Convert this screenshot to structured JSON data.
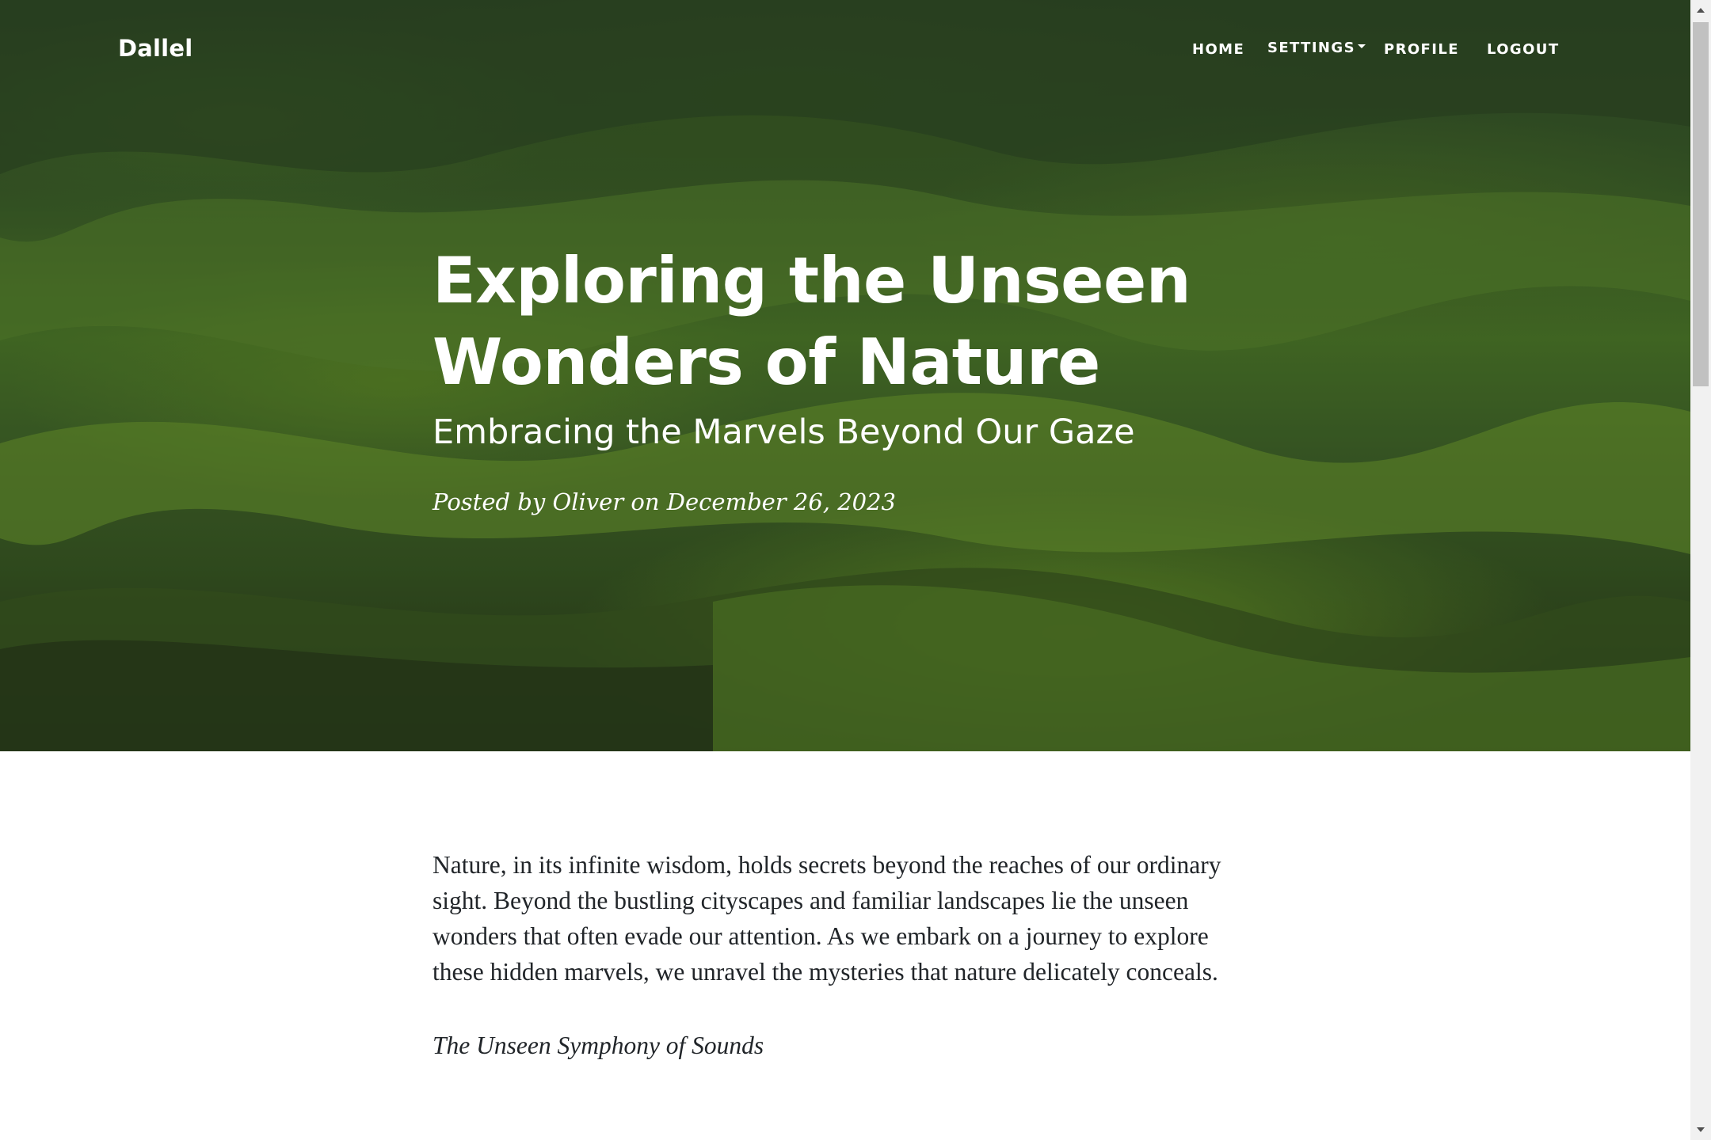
{
  "brand": "Dallel",
  "nav": {
    "home": "HOME",
    "settings": "SETTINGS",
    "profile": "PROFILE",
    "logout": "LOGOUT"
  },
  "hero": {
    "title": "Exploring the Unseen Wonders of Nature",
    "subtitle": "Embracing the Marvels Beyond Our Gaze",
    "meta": "Posted by Oliver on December 26, 2023"
  },
  "article": {
    "intro": "Nature, in its infinite wisdom, holds secrets beyond the reaches of our ordinary sight. Beyond the bustling cityscapes and familiar landscapes lie the unseen wonders that often evade our attention. As we embark on a journey to explore these hidden marvels, we unravel the mysteries that nature delicately conceals.",
    "section_heading": "The Unseen Symphony of Sounds"
  },
  "icons": {
    "dropdown": "caret-down-icon",
    "scroll_up": "arrow-up-icon",
    "scroll_down": "arrow-down-icon"
  }
}
